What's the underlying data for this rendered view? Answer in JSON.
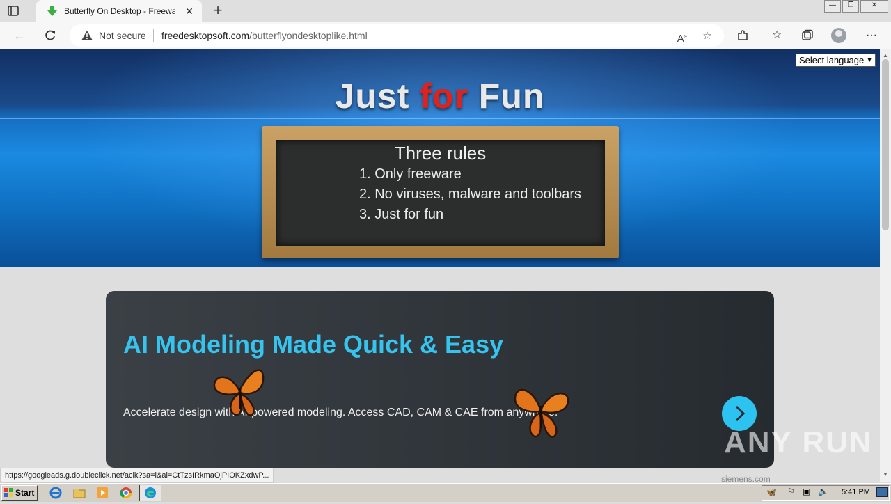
{
  "browser": {
    "tab_title": "Butterfly On Desktop - Freeware",
    "new_tab_label": "+",
    "security_label": "Not secure",
    "url_domain": "freedesktopsoft.com",
    "url_path": "/butterflyondesktoplike.html",
    "window_minimize": "—",
    "window_restore": "❐",
    "window_close": "✕"
  },
  "page": {
    "language_select": "Select language",
    "logo": {
      "part1": "Just ",
      "part2": "for",
      "part3": " Fun"
    },
    "chalkboard": {
      "heading": "Three rules",
      "rules": [
        "1. Only freeware",
        "2. No viruses, malware and toolbars",
        "3. Just for fun"
      ]
    },
    "ad": {
      "headline": "AI Modeling Made Quick & Easy",
      "body": "Accelerate design with AI-powered modeling. Access CAD, CAM & CAE from anywhere.",
      "sponsor": "siemens.com"
    },
    "watermark": "ANY RUN"
  },
  "status_bar": {
    "link_url": "https://googleads.g.doubleclick.net/aclk?sa=l&ai=CtTzsIRkmaOjPIOKZxdwP..."
  },
  "taskbar": {
    "start_label": "Start",
    "clock": "5:41 PM"
  },
  "colors": {
    "accent_cyan": "#36c3ee",
    "logo_red": "#e0221c",
    "hero_blue": "#1b8ae0"
  }
}
